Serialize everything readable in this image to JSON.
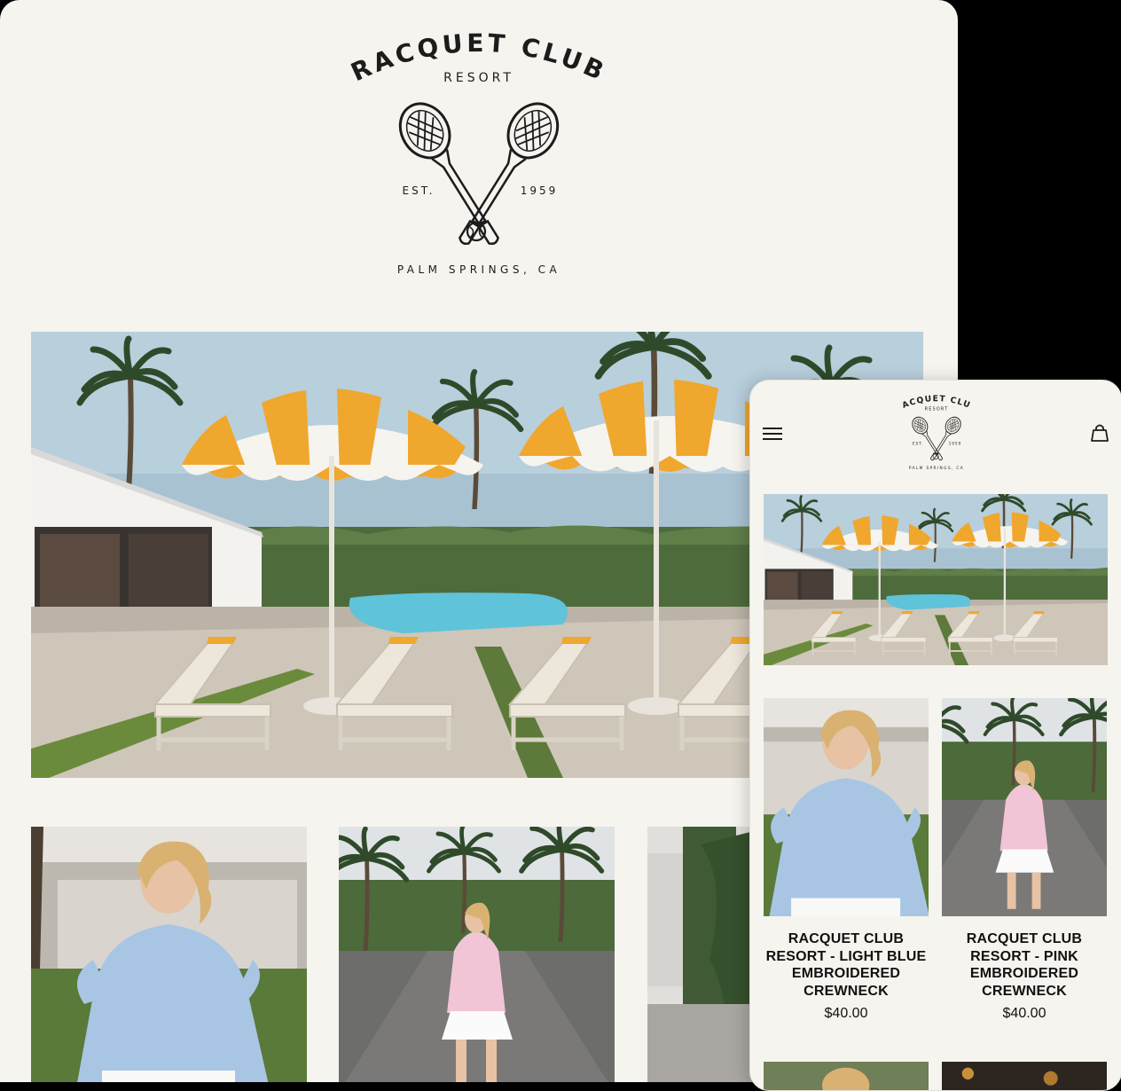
{
  "brand": {
    "name_line1": "RACQUET CLUB",
    "name_line2": "RESORT",
    "est_left": "EST.",
    "est_right": "1959",
    "location": "PALM SPRINGS, CA"
  },
  "mobile": {
    "menu_icon": "hamburger-menu-icon",
    "cart_icon": "shopping-bag-icon",
    "products": [
      {
        "title_lines": [
          "RACQUET CLUB",
          "RESORT - LIGHT BLUE",
          "EMBROIDERED",
          "CREWNECK"
        ],
        "price": "$40.00"
      },
      {
        "title_lines": [
          "RACQUET CLUB",
          "RESORT - PINK",
          "EMBROIDERED",
          "CREWNECK"
        ],
        "price": "$40.00"
      }
    ]
  },
  "colors": {
    "background": "#f6f4ef",
    "umbrella_orange": "#f0a72e",
    "sky": "#a9c2d2",
    "text": "#111111"
  }
}
